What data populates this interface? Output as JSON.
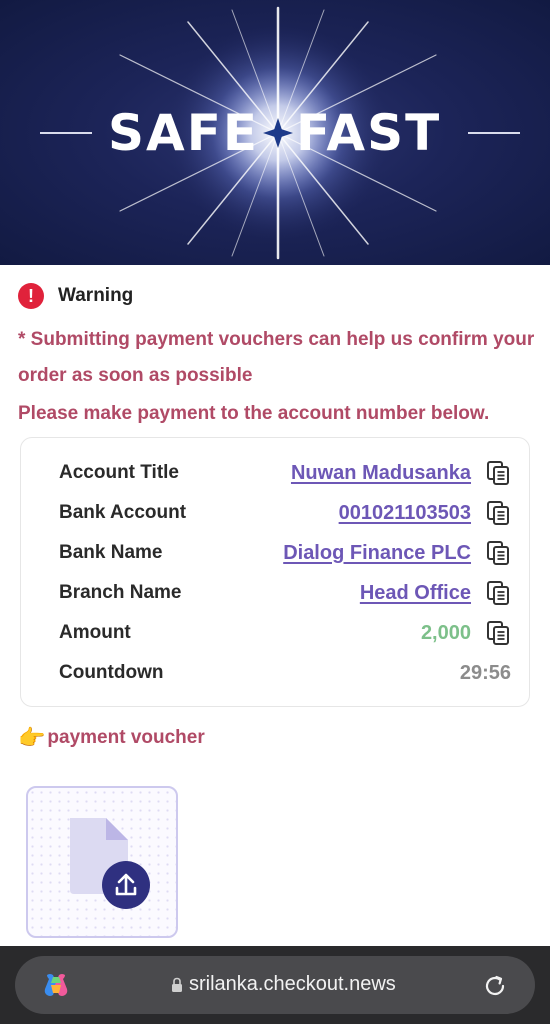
{
  "banner": {
    "word_left": "SAFE",
    "word_right": "FAST"
  },
  "warning": {
    "icon": "exclamation-icon",
    "label": "Warning",
    "message": "* Submitting payment vouchers can help us confirm your order as soon as possible",
    "instruction": "Please make payment to the account number below."
  },
  "account": {
    "rows": [
      {
        "label": "Account Title",
        "value": "Nuwan Madusanka"
      },
      {
        "label": "Bank Account",
        "value": "001021103503"
      },
      {
        "label": "Bank Name",
        "value": "Dialog Finance PLC"
      },
      {
        "label": "Branch Name",
        "value": "Head Office"
      },
      {
        "label": "Amount",
        "value": "2,000"
      },
      {
        "label": "Countdown",
        "value": "29:56"
      }
    ]
  },
  "voucher": {
    "hand_emoji": "👉",
    "label": "payment voucher"
  },
  "browser": {
    "url": "srilanka.checkout.news"
  },
  "colors": {
    "accent_pink": "#b04a66",
    "link_purple": "#6d57b6",
    "amount_green": "#7dc08a",
    "warning_red": "#e0223b"
  }
}
